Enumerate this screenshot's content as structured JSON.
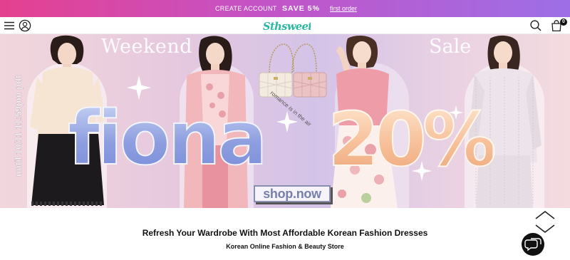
{
  "promo": {
    "create_account": "CREATE ACCOUNT",
    "save": "SAVE 5%",
    "first_order": "first order"
  },
  "header": {
    "logo": "Sthsweet",
    "cart_count": "0"
  },
  "hero": {
    "weekend": "Weekend",
    "sale": "Sale",
    "brand": "fiona",
    "discount": "20%",
    "shop_button": "shop.now",
    "until": "until 10/11 11:59pm pdt",
    "bags_caption": "romance is in the air"
  },
  "main": {
    "headline": "Refresh Your Wardrobe With Most Affordable Korean Fashion Dresses",
    "subheadline": "Korean Online Fashion & Beauty Store"
  },
  "colors": {
    "promo_start": "#e5408f",
    "promo_end": "#9d6fe6",
    "logo": "#2bb8a2",
    "fiona_blue": "#8e9fe0",
    "discount_peach": "#f7c09a"
  }
}
